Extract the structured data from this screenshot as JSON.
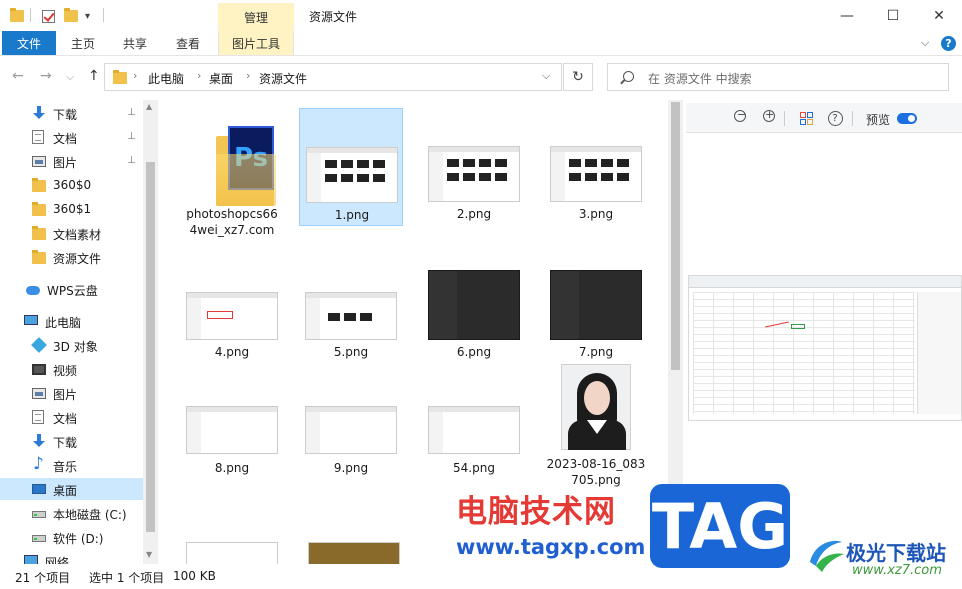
{
  "titlebar": {
    "title": "资源文件",
    "manage_tab": "管理",
    "minimize_glyph": "—",
    "maximize_glyph": "☐",
    "close_glyph": "✕"
  },
  "ribbon": {
    "tabs": [
      "文件",
      "主页",
      "共享",
      "查看",
      "图片工具"
    ],
    "expand_glyph": "⌵",
    "help_glyph": "?"
  },
  "nav": {
    "back_glyph": "←",
    "forward_glyph": "→",
    "recent_glyph": "⌵",
    "up_glyph": "↑",
    "breadcrumb": [
      "此电脑",
      "桌面",
      "资源文件"
    ],
    "dropdown_glyph": "⌵",
    "refresh_glyph": "↻",
    "search_placeholder": "在 资源文件 中搜索"
  },
  "sidebar": {
    "items": [
      {
        "label": "下载",
        "icon": "download-icon",
        "pinned": true
      },
      {
        "label": "文档",
        "icon": "document-icon",
        "pinned": true
      },
      {
        "label": "图片",
        "icon": "picture-icon",
        "pinned": true
      },
      {
        "label": "360$0",
        "icon": "folder-icon"
      },
      {
        "label": "360$1",
        "icon": "folder-icon"
      },
      {
        "label": "文档素材",
        "icon": "folder-icon"
      },
      {
        "label": "资源文件",
        "icon": "folder-icon"
      },
      {
        "label": "WPS云盘",
        "icon": "cloud-icon"
      },
      {
        "label": "此电脑",
        "icon": "computer-icon"
      },
      {
        "label": "3D 对象",
        "icon": "3d-objects-icon"
      },
      {
        "label": "视频",
        "icon": "video-icon"
      },
      {
        "label": "图片",
        "icon": "picture-icon"
      },
      {
        "label": "文档",
        "icon": "document-icon"
      },
      {
        "label": "下载",
        "icon": "download-icon"
      },
      {
        "label": "音乐",
        "icon": "music-icon"
      },
      {
        "label": "桌面",
        "icon": "desktop-icon",
        "selected": true
      },
      {
        "label": "本地磁盘 (C:)",
        "icon": "drive-icon"
      },
      {
        "label": "软件 (D:)",
        "icon": "drive-icon"
      },
      {
        "label": "网络",
        "icon": "network-icon"
      }
    ],
    "pin_glyph": "📌"
  },
  "files": [
    {
      "name": "photoshopcs664wei_xz7.com",
      "line1": "photoshopcs66",
      "line2": "4wei_xz7.com",
      "kind": "ps-folder"
    },
    {
      "name": "1.png",
      "kind": "screenshot",
      "selected": true
    },
    {
      "name": "2.png",
      "kind": "screenshot"
    },
    {
      "name": "3.png",
      "kind": "screenshot"
    },
    {
      "name": "4.png",
      "kind": "screenshot"
    },
    {
      "name": "5.png",
      "kind": "screenshot"
    },
    {
      "name": "6.png",
      "kind": "dark"
    },
    {
      "name": "7.png",
      "kind": "dark"
    },
    {
      "name": "8.png",
      "kind": "screenshot"
    },
    {
      "name": "9.png",
      "kind": "screenshot"
    },
    {
      "name": "54.png",
      "kind": "screenshot"
    },
    {
      "name": "2023-08-16_083705.png",
      "line1": "2023-08-16_083",
      "line2": "705.png",
      "kind": "photo"
    }
  ],
  "preview": {
    "zoom_out_glyph": "−",
    "zoom_in_glyph": "+",
    "help_glyph": "?",
    "label": "预览",
    "toggle_on": true
  },
  "status": {
    "item_count": "21 个项目",
    "selection": "选中 1 个项目",
    "size": "100 KB"
  },
  "watermarks": {
    "site_cn": "电脑技术网",
    "site_url": "www.tagxp.com",
    "tag": "TAG",
    "brand": "极光下载站",
    "brand_url": "www.xz7.com"
  },
  "colors": {
    "accent": "#1979ca",
    "selection": "#cce8ff",
    "manage_tab": "#fff3c4"
  }
}
